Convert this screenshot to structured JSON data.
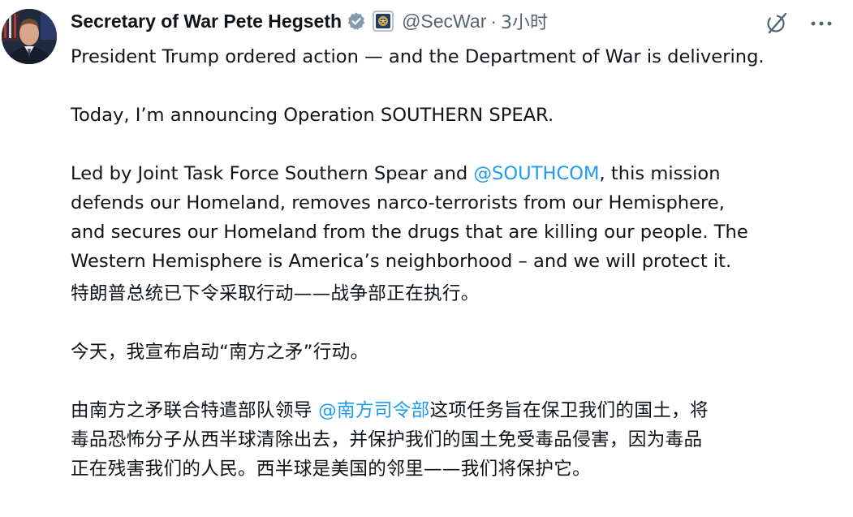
{
  "author": {
    "display_name": "Secretary of War Pete Hegseth",
    "handle": "@SecWar",
    "separator": "·",
    "time": "3小时",
    "avatar_icon": "person-portrait-avatar",
    "verified_icon": "verified-badge-icon",
    "affiliate_icon": "department-seal-icon"
  },
  "actions": {
    "grok_icon": "grok-icon",
    "more_icon": "more-options-icon"
  },
  "tweet": {
    "en_p1": "President Trump ordered action — and the Department of War is delivering.",
    "en_p2": "Today, I’m announcing Operation SOUTHERN SPEAR.",
    "en_p3_before": "Led by Joint Task Force Southern Spear and ",
    "en_p3_mention": "@SOUTHCOM",
    "en_p3_line1_after": ", this mission",
    "en_p3_line2": "defends our Homeland, removes narco-terrorists from our Hemisphere,",
    "en_p3_line3": "and secures our Homeland from the drugs that are killing our people. The",
    "en_p3_line4": "Western Hemisphere is America’s neighborhood – and we will protect it.",
    "zh_p1": "特朗普总统已下令采取行动——战争部正在执行。",
    "zh_p2": "今天，我宣布启动“南方之矛”行动。",
    "zh_p3_before": "由南方之矛联合特遣部队领导 ",
    "zh_p3_mention": "@南方司令部",
    "zh_p3_line1_after": "这项任务旨在保卫我们的国土，将",
    "zh_p3_line2": "毒品恐怖分子从西半球清除出去，并保护我们的国土免受毒品侵害，因为毒品",
    "zh_p3_line3": "正在残害我们的人民。西半球是美国的邻里——我们将保护它。"
  },
  "colors": {
    "text": "#0f1419",
    "secondary": "#536471",
    "link": "#1d9bf0",
    "verified_badge": "#829aab"
  }
}
